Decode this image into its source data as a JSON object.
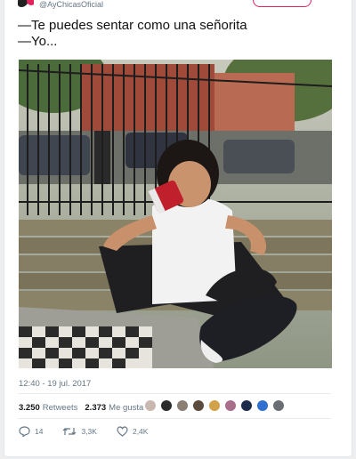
{
  "header": {
    "handle": "@AyChicasOficial"
  },
  "tweet": {
    "lines": [
      "—Te puedes sentar como una señorita",
      "—Yo..."
    ],
    "timestamp": "12:40 - 19 jul. 2017"
  },
  "stats": {
    "retweets_count": "3.250",
    "retweets_label": "Retweets",
    "likes_count": "2.373",
    "likes_label": "Me gusta"
  },
  "likers": [
    {
      "color": "#c9b8b0"
    },
    {
      "color": "#2b2b2b"
    },
    {
      "color": "#8a7e75"
    },
    {
      "color": "#5c4a3e"
    },
    {
      "color": "#d1a24a"
    },
    {
      "color": "#a86e8a"
    },
    {
      "color": "#1d2c4a"
    },
    {
      "color": "#2f6fd0"
    },
    {
      "color": "#6b6f74"
    }
  ],
  "actions": {
    "reply_count": "14",
    "retweet_count": "3,3K",
    "like_count": "2,4K"
  },
  "colors": {
    "brand": "#e0245e",
    "muted": "#657786",
    "divider": "#e6ecf0"
  }
}
